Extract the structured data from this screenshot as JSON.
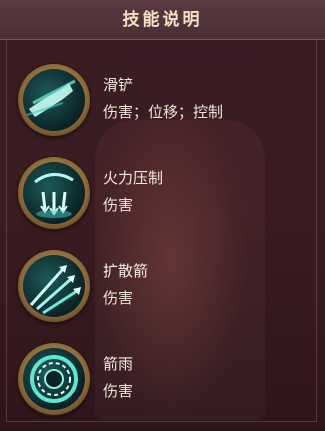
{
  "panel": {
    "title": "技能说明"
  },
  "skills": [
    {
      "name": "滑铲",
      "tags": "伤害；位移；控制",
      "icon": "slide-kick-icon"
    },
    {
      "name": "火力压制",
      "tags": "伤害",
      "icon": "arrow-barrage-icon"
    },
    {
      "name": "扩散箭",
      "tags": "伤害",
      "icon": "spread-arrows-icon"
    },
    {
      "name": "箭雨",
      "tags": "伤害",
      "icon": "arrow-rain-ring-icon"
    }
  ],
  "colors": {
    "accent": "#2fe0c0",
    "title": "#f2e3c4",
    "frame": "#caa86a"
  }
}
